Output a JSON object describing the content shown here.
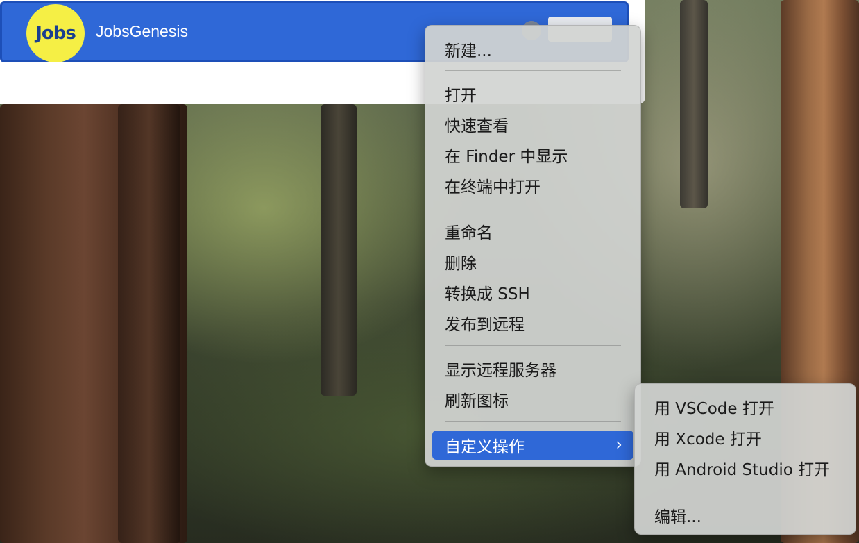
{
  "app": {
    "logo_text": "Jobs",
    "title": "JobsGenesis"
  },
  "context_menu": {
    "items": [
      {
        "label": "新建..."
      },
      {
        "label": "打开"
      },
      {
        "label": "快速查看"
      },
      {
        "label": "在 Finder 中显示"
      },
      {
        "label": "在终端中打开"
      },
      {
        "label": "重命名"
      },
      {
        "label": "删除"
      },
      {
        "label": "转换成 SSH"
      },
      {
        "label": "发布到远程"
      },
      {
        "label": "显示远程服务器"
      },
      {
        "label": "刷新图标"
      },
      {
        "label": "自定义操作",
        "state": "highlighted",
        "icon": "chevron-right-icon"
      }
    ],
    "highlight_color": "#2f68d7"
  },
  "submenu": {
    "items": [
      {
        "label": "用 VSCode 打开"
      },
      {
        "label": "用 Xcode 打开"
      },
      {
        "label": "用 Android Studio 打开"
      },
      {
        "label": "编辑..."
      }
    ]
  },
  "colors": {
    "header_blue": "#2f68d7",
    "logo_yellow": "#f5ef45"
  }
}
